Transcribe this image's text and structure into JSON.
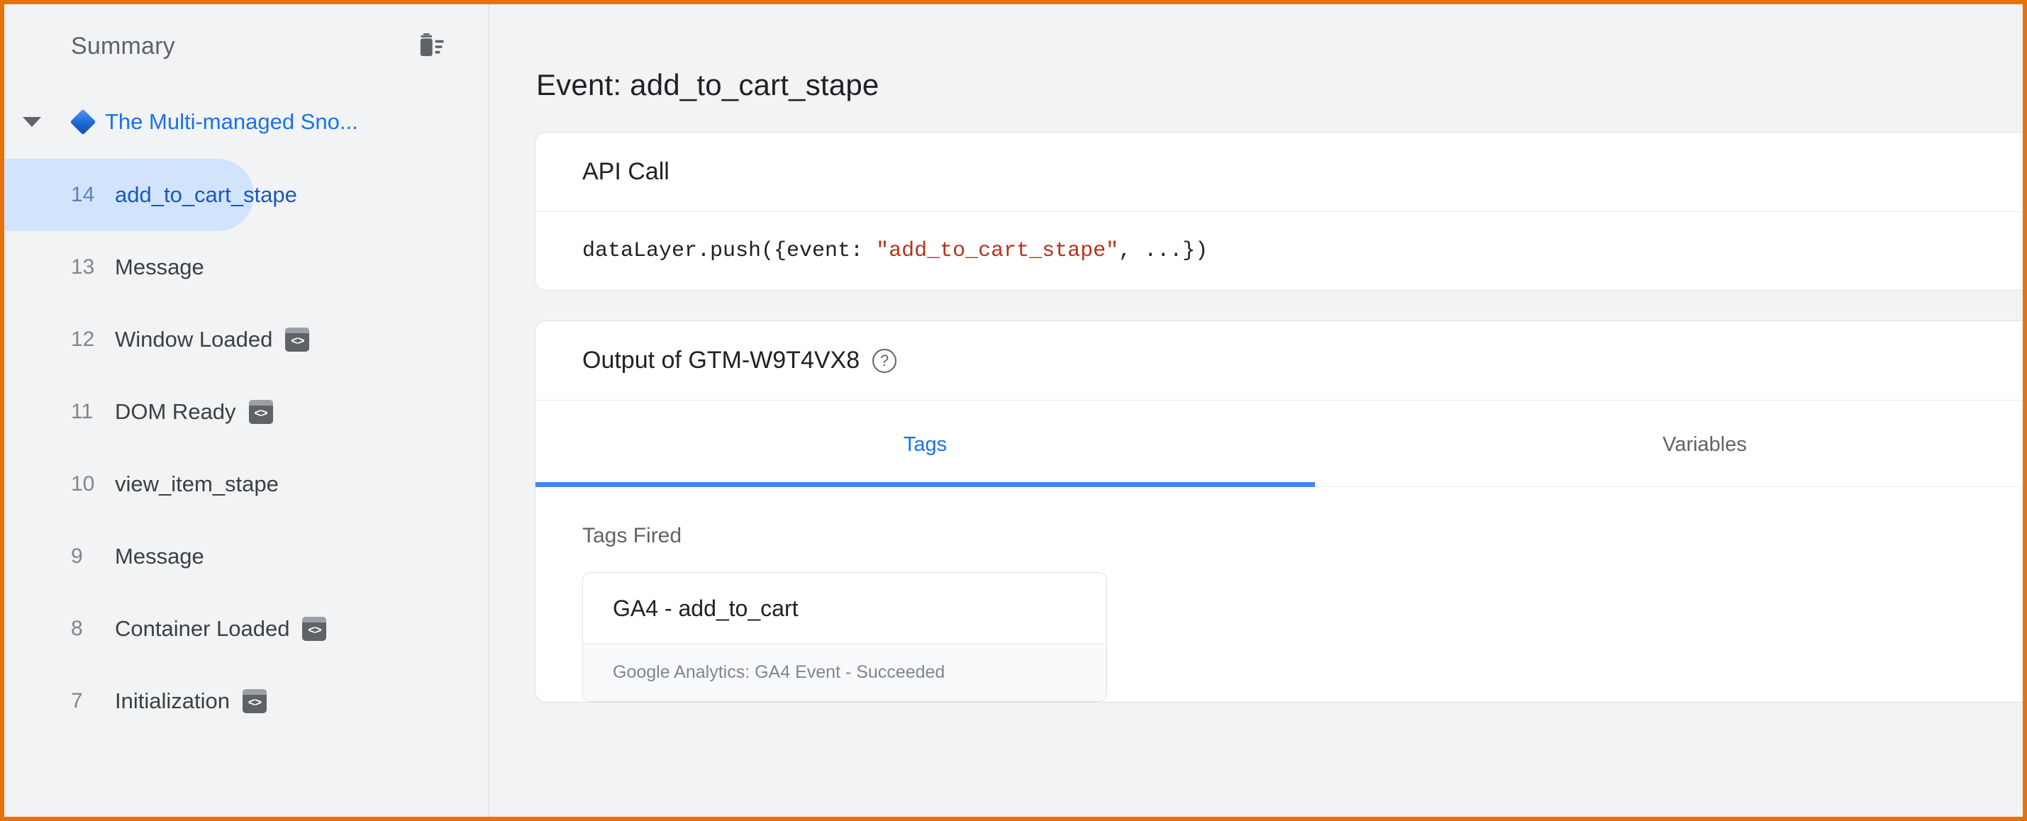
{
  "theme": {
    "accent_blue": "#1a73e8",
    "tab_underline": "#4285f4",
    "selected_row_bg": "#d2e3fc",
    "annotation_border": "#e8710a",
    "panel_bg": "#f1f3f4",
    "string_literal": "#b7321d"
  },
  "sidebar": {
    "title": "Summary",
    "clear_icon": "trash-clear-icon",
    "container_tree": {
      "caret_icon": "chevron-down-icon",
      "container_icon": "blue-diamond-icon",
      "label": "The Multi-managed Sno..."
    },
    "events": [
      {
        "index": "14",
        "label": "add_to_cart_stape",
        "selected": true,
        "has_code_icon": false
      },
      {
        "index": "13",
        "label": "Message",
        "selected": false,
        "has_code_icon": false
      },
      {
        "index": "12",
        "label": "Window Loaded",
        "selected": false,
        "has_code_icon": true
      },
      {
        "index": "11",
        "label": "DOM Ready",
        "selected": false,
        "has_code_icon": true
      },
      {
        "index": "10",
        "label": "view_item_stape",
        "selected": false,
        "has_code_icon": false
      },
      {
        "index": "9",
        "label": "Message",
        "selected": false,
        "has_code_icon": false
      },
      {
        "index": "8",
        "label": "Container Loaded",
        "selected": false,
        "has_code_icon": true
      },
      {
        "index": "7",
        "label": "Initialization",
        "selected": false,
        "has_code_icon": true
      }
    ],
    "code_icon_glyph": "<>"
  },
  "main": {
    "heading": "Event: add_to_cart_stape",
    "api_call_card": {
      "header": "API Call",
      "code_prefix": "dataLayer.push({event: ",
      "code_string": "\"add_to_cart_stape\"",
      "code_suffix": ", ...})"
    },
    "output_card": {
      "header": "Output of GTM-W9T4VX8",
      "help_icon": "help-circle-icon",
      "help_glyph": "?",
      "tabs": [
        {
          "label": "Tags",
          "active": true
        },
        {
          "label": "Variables",
          "active": false
        }
      ],
      "tags_panel": {
        "section_label": "Tags Fired",
        "tags": [
          {
            "name": "GA4 - add_to_cart",
            "status": "Google Analytics: GA4 Event - Succeeded"
          }
        ]
      }
    }
  }
}
